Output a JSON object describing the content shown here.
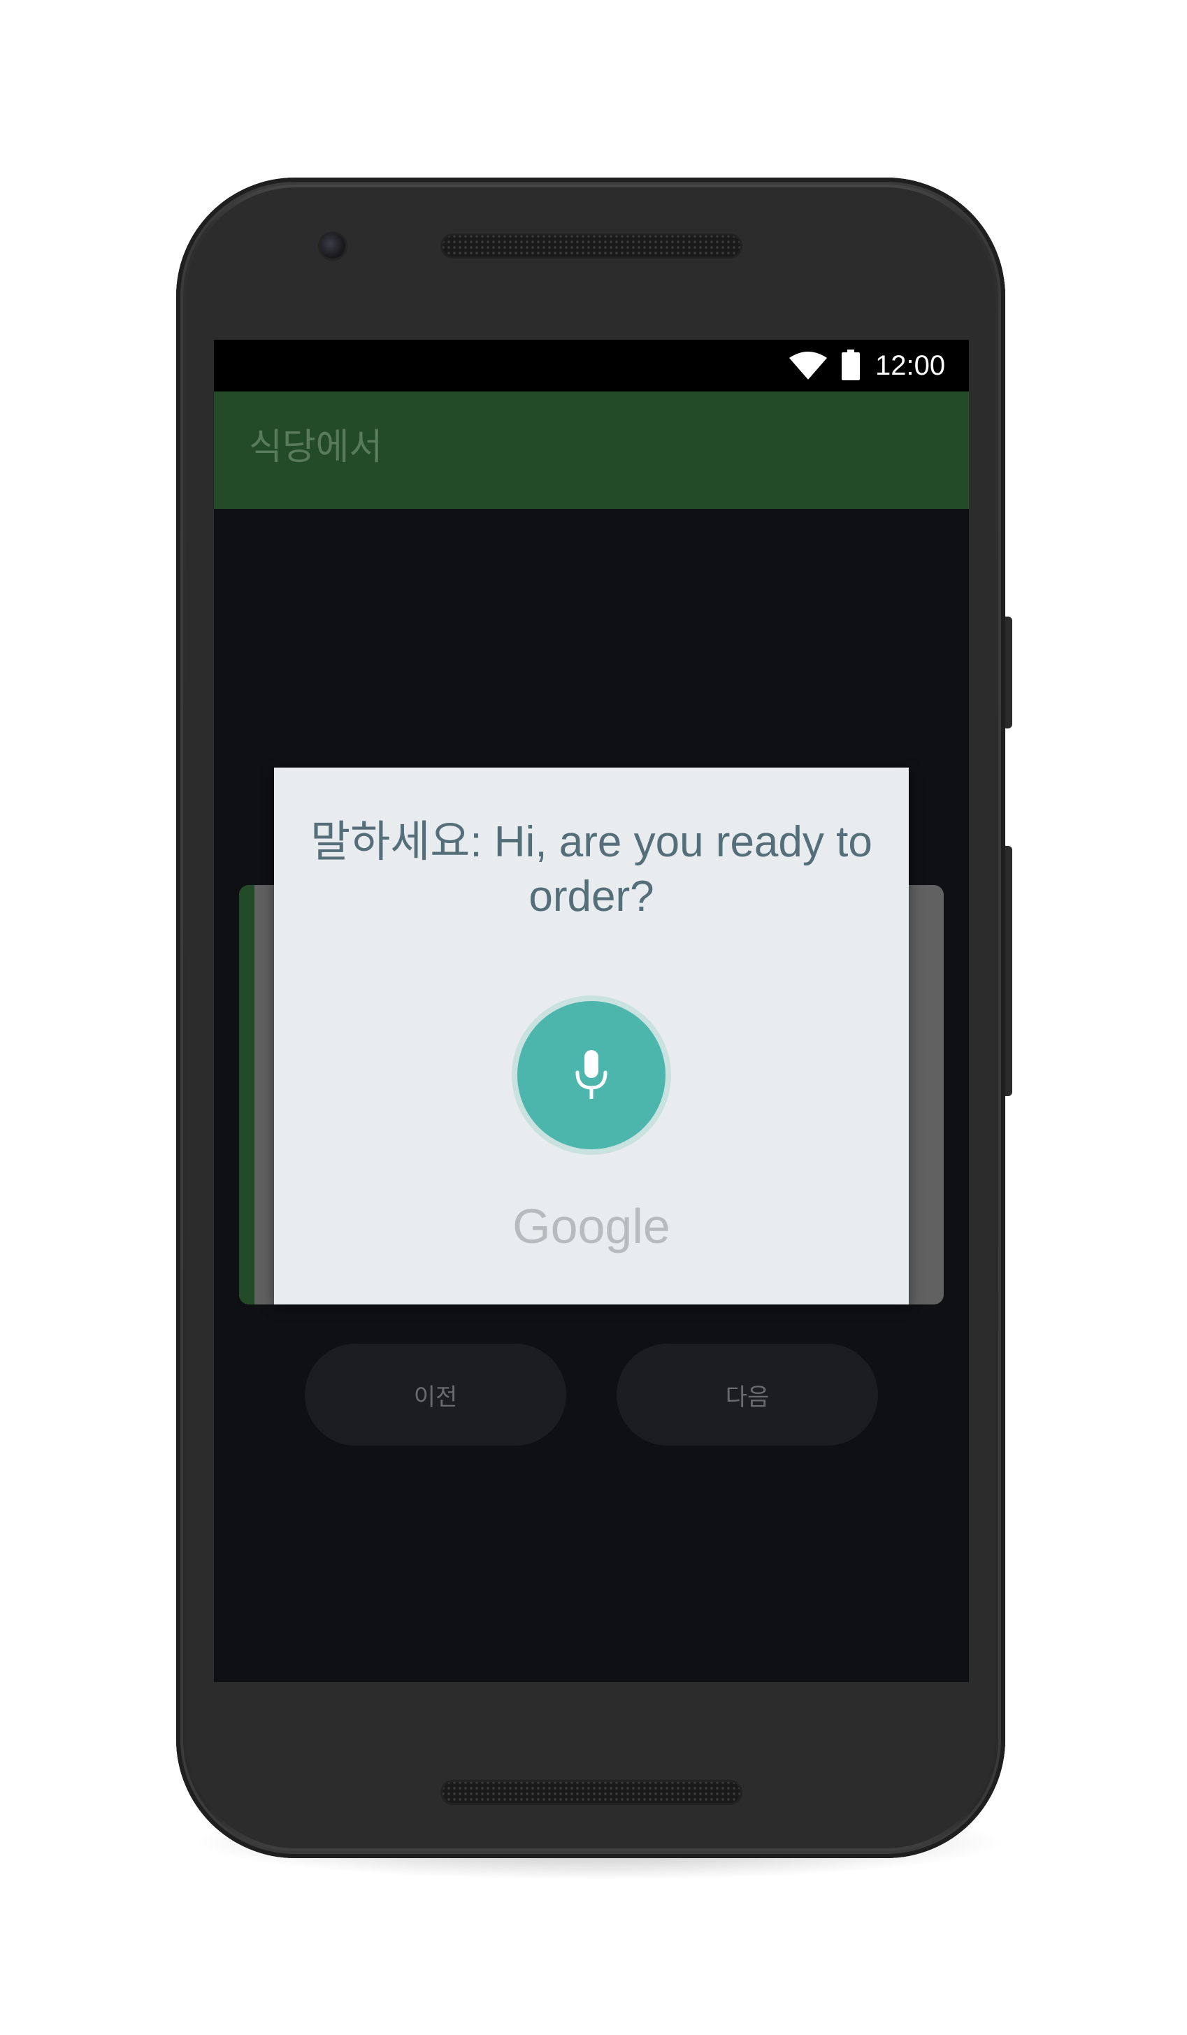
{
  "status_bar": {
    "time": "12:00",
    "icons": [
      "wifi-icon",
      "battery-icon"
    ]
  },
  "app_bar": {
    "title": "식당에서"
  },
  "navigation": {
    "prev_label": "이전",
    "next_label": "다음"
  },
  "speech_dialog": {
    "prompt": "말하세요: Hi, are you ready to order?",
    "mic_icon": "microphone-icon",
    "brand": "Google"
  },
  "colors": {
    "app_bar": "#244b27",
    "mic_button": "#4db6ac",
    "prompt_text": "#546e7a",
    "dialog_bg": "#e9ecef",
    "screen_bg": "#0f1014"
  }
}
